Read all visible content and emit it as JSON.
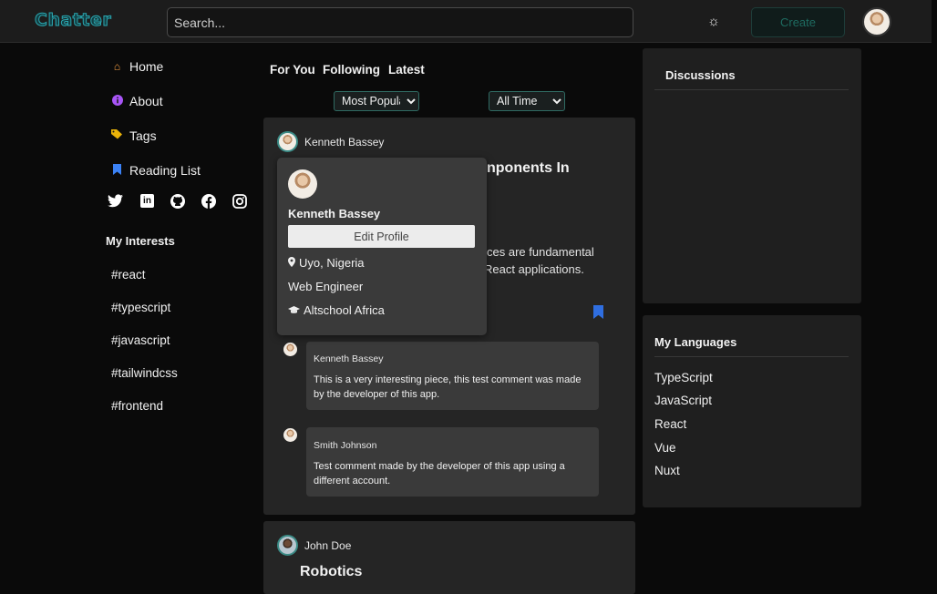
{
  "header": {
    "logo": "Chatter",
    "search_placeholder": "Search...",
    "theme_icon": "☼",
    "create_label": "Create"
  },
  "sidebar": {
    "items": [
      {
        "label": "Home",
        "icon": "home-icon",
        "color": "#f59e42"
      },
      {
        "label": "About",
        "icon": "info-icon",
        "color": "#a855f7"
      },
      {
        "label": "Tags",
        "icon": "tags-icon",
        "color": "#eab308"
      },
      {
        "label": "Reading List",
        "icon": "bookmark-icon",
        "color": "#3b82f6"
      }
    ],
    "social": [
      "twitter-icon",
      "linkedin-icon",
      "github-icon",
      "facebook-icon",
      "instagram-icon"
    ],
    "interests_title": "My Interests",
    "interests": [
      "#react",
      "#typescript",
      "#javascript",
      "#tailwindcss",
      "#frontend"
    ]
  },
  "feed": {
    "tabs": [
      "For You",
      "Following",
      "Latest"
    ],
    "sort_selected": "Most Popular",
    "time_selected": "All Time",
    "posts": [
      {
        "author": "Kenneth Bassey",
        "title_visible": "nponents In",
        "body_line1": "ces are fundamental",
        "body_line2": "React applications.",
        "comments": [
          {
            "author": "Kenneth Bassey",
            "text": "This is a very interesting piece, this test comment was made by the developer of this app."
          },
          {
            "author": "Smith Johnson",
            "text": "Test comment made by the developer of this app using a different account."
          }
        ]
      },
      {
        "author": "John Doe",
        "title": "Robotics"
      }
    ]
  },
  "profile_popup": {
    "name": "Kenneth Bassey",
    "edit_label": "Edit Profile",
    "location": "Uyo, Nigeria",
    "role": "Web Engineer",
    "school": "Altschool Africa"
  },
  "right": {
    "discussions_title": "Discussions",
    "languages_title": "My Languages",
    "languages": [
      "TypeScript",
      "JavaScript",
      "React",
      "Vue",
      "Nuxt"
    ]
  }
}
